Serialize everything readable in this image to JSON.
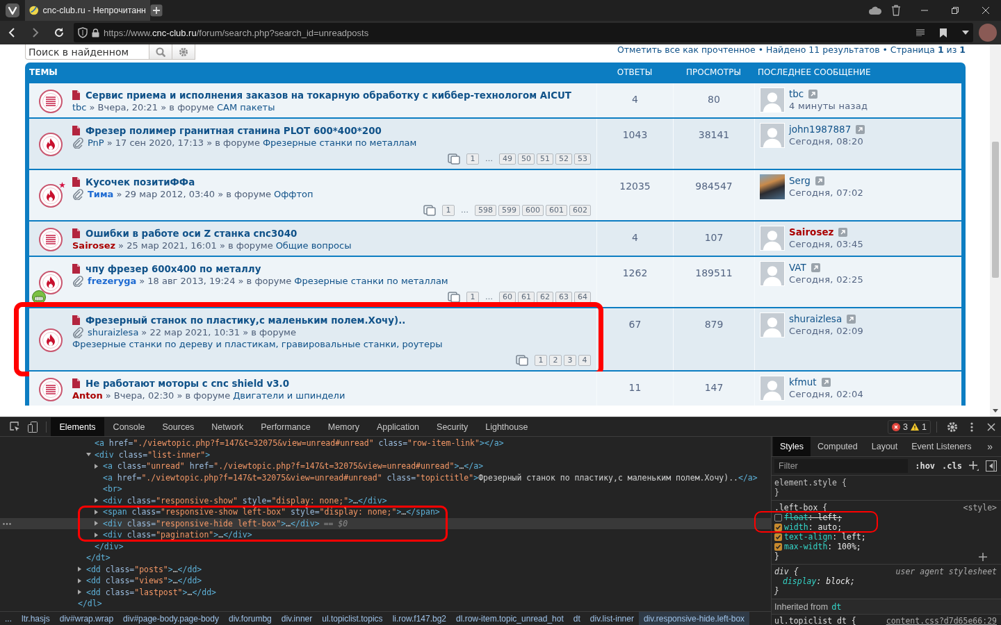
{
  "browser": {
    "tab": {
      "title": "cnc-club.ru - Непрочитанн",
      "selected": true
    },
    "url": {
      "scheme": "https://www.",
      "domain": "cnc-club.ru",
      "path": "/forum/search.php?search_id=unreadposts"
    }
  },
  "search": {
    "placeholder": "Поиск в найденном"
  },
  "search_info": {
    "mark_read": "Отметить все как прочтенное",
    "summary": "• Найдено 11 результатов • Страница **1** из **1**"
  },
  "table": {
    "columns": [
      "ТЕМЫ",
      "ОТВЕТЫ",
      "ПРОСМОТРЫ",
      "ПОСЛЕДНЕЕ СООБЩЕНИЕ"
    ],
    "rows": [
      {
        "kind": "topic",
        "mine": false,
        "attachment": false,
        "smiley": false,
        "highlighted": false,
        "title": "Сервис приема и исполнения заказов на токарную обработку с киббер-технологом AICUT",
        "author": {
          "name": "tbc",
          "kind": "regular"
        },
        "info": "» Вчера, 20:21 » в форуме",
        "forum": "CAM пакеты",
        "replies": "4",
        "views": "80",
        "last_post": {
          "author": {
            "name": "tbc",
            "kind": "regular"
          },
          "avatar": {
            "kind": "default"
          },
          "time": "4 минуты назад"
        }
      },
      {
        "kind": "hot",
        "mine": false,
        "attachment": true,
        "smiley": false,
        "highlighted": false,
        "title": "Фрезер полимер гранитная станина PLOT 600*400*200",
        "author": {
          "name": "PnP",
          "kind": "regular"
        },
        "info": "» 17 сен 2020, 17:13 » в форуме",
        "forum": "Фрезерные станки по металлам",
        "pages": [
          {
            "kind": "page",
            "label": "1"
          },
          {
            "kind": "gap",
            "label": "…"
          },
          {
            "kind": "page",
            "label": "49"
          },
          {
            "kind": "page",
            "label": "50"
          },
          {
            "kind": "page",
            "label": "51"
          },
          {
            "kind": "page",
            "label": "52"
          },
          {
            "kind": "page",
            "label": "53"
          }
        ],
        "replies": "1043",
        "views": "38141",
        "last_post": {
          "author": {
            "name": "john1987887",
            "kind": "regular"
          },
          "avatar": {
            "kind": "default"
          },
          "time": "Сегодня, 08:20"
        }
      },
      {
        "kind": "hot",
        "mine": true,
        "attachment": true,
        "smiley": false,
        "highlighted": false,
        "title": "Кусочек позитиФФа",
        "author": {
          "name": "Тима",
          "kind": "active"
        },
        "info": "» 29 мар 2012, 03:40 » в форуме",
        "forum": "Оффтоп",
        "pages": [
          {
            "kind": "page",
            "label": "1"
          },
          {
            "kind": "gap",
            "label": "…"
          },
          {
            "kind": "page",
            "label": "598"
          },
          {
            "kind": "page",
            "label": "599"
          },
          {
            "kind": "page",
            "label": "600"
          },
          {
            "kind": "page",
            "label": "601"
          },
          {
            "kind": "page",
            "label": "602"
          }
        ],
        "replies": "12035",
        "views": "984547",
        "last_post": {
          "author": {
            "name": "Serg",
            "kind": "regular"
          },
          "avatar": {
            "kind": "photo"
          },
          "time": "Сегодня, 07:02"
        }
      },
      {
        "kind": "topic",
        "mine": false,
        "attachment": false,
        "smiley": false,
        "highlighted": false,
        "title": "Ошибки в работе оси Z станка cnc3040",
        "author": {
          "name": "Sairosez",
          "kind": "staff"
        },
        "info": "» 25 мар 2021, 16:01 » в форуме",
        "forum": "Общие вопросы",
        "replies": "4",
        "views": "107",
        "last_post": {
          "author": {
            "name": "Sairosez",
            "kind": "staff"
          },
          "avatar": {
            "kind": "default"
          },
          "time": "Сегодня, 03:45"
        }
      },
      {
        "kind": "hot",
        "mine": false,
        "attachment": true,
        "smiley": true,
        "highlighted": false,
        "title": "чпу фрезер 600x400 по металлу",
        "author": {
          "name": "frezeryga",
          "kind": "active"
        },
        "info": "» 18 авг 2013, 19:24 » в форуме",
        "forum": "Фрезерные станки по металлам",
        "pages": [
          {
            "kind": "page",
            "label": "1"
          },
          {
            "kind": "gap",
            "label": "…"
          },
          {
            "kind": "page",
            "label": "60"
          },
          {
            "kind": "page",
            "label": "61"
          },
          {
            "kind": "page",
            "label": "62"
          },
          {
            "kind": "page",
            "label": "63"
          },
          {
            "kind": "page",
            "label": "64"
          }
        ],
        "replies": "1262",
        "views": "189511",
        "last_post": {
          "author": {
            "name": "VAT",
            "kind": "regular"
          },
          "avatar": {
            "kind": "default"
          },
          "time": "Сегодня, 02:25"
        }
      },
      {
        "kind": "hot",
        "mine": false,
        "attachment": true,
        "smiley": false,
        "highlighted": true,
        "title": "Фрезерный станок по пластику,с маленьким полем.Хочу)..",
        "author": {
          "name": "shuraizlesa",
          "kind": "regular"
        },
        "info": "» 22 мар 2021, 10:31 » в форуме",
        "forum": "Фрезерные станки по дереву и пластикам, гравировальные станки, роутеры",
        "pages": [
          {
            "kind": "page",
            "label": "1"
          },
          {
            "kind": "page",
            "label": "2"
          },
          {
            "kind": "page",
            "label": "3"
          },
          {
            "kind": "page",
            "label": "4"
          }
        ],
        "replies": "67",
        "views": "879",
        "last_post": {
          "author": {
            "name": "shuraizlesa",
            "kind": "regular"
          },
          "avatar": {
            "kind": "default"
          },
          "time": "Сегодня, 02:09"
        }
      },
      {
        "kind": "topic",
        "mine": false,
        "attachment": false,
        "smiley": false,
        "highlighted": false,
        "title": "Не работают моторы с cnc shield v3.0",
        "author": {
          "name": "Anton",
          "kind": "staff"
        },
        "info": "» Вчера, 02:30 » в форуме",
        "forum": "Двигатели и шпиндели",
        "replies": "11",
        "views": "147",
        "last_post": {
          "author": {
            "name": "kfmut",
            "kind": "regular"
          },
          "avatar": {
            "kind": "default"
          },
          "time": "Сегодня, 02:04"
        }
      }
    ]
  },
  "devtools": {
    "tabs": [
      {
        "label": "Elements",
        "selected": true
      },
      {
        "label": "Console",
        "selected": false
      },
      {
        "label": "Sources",
        "selected": false
      },
      {
        "label": "Network",
        "selected": false
      },
      {
        "label": "Performance",
        "selected": false
      },
      {
        "label": "Memory",
        "selected": false
      },
      {
        "label": "Application",
        "selected": false
      },
      {
        "label": "Security",
        "selected": false
      },
      {
        "label": "Lighthouse",
        "selected": false
      }
    ],
    "issues": {
      "errors": "3",
      "warnings": "1"
    },
    "dom_tree": {
      "closing": "</dl>",
      "children": [
        {
          "closing": "</dt>",
          "children": [
            {
              "markup": "<a href=\"./viewtopic.php?f=147&t=32075&view=unread#unread\" class=\"row-item-link\"></a>",
              "selected": false
            },
            {
              "markup": "<div class=\"list-inner\">",
              "expanded": true,
              "selected": false,
              "closing": "</div>",
              "children": [
                {
                  "markup": "<a class=\"unread\" href=\"./viewtopic.php?f=147&t=32075&view=unread#unread\">…</a>",
                  "expanded": false,
                  "selected": false
                },
                {
                  "markup": "<a href=\"./viewtopic.php?f=147&t=32075&view=unread#unread\" class=\"topictitle\">Фрезерный станок по пластику,с маленьким полем.Хочу)..</a>",
                  "selected": false
                },
                {
                  "markup": "<br>",
                  "selected": false
                },
                {
                  "markup": "<div class=\"responsive-show\" style=\"display: none;\">…</div>",
                  "expanded": false,
                  "selected": false
                },
                {
                  "markup": "<span class=\"responsive-show left-box\" style=\"display: none;\">…</span>",
                  "expanded": false,
                  "selected": false
                },
                {
                  "markup": "<div class=\"responsive-hide left-box\">…</div>",
                  "badge": "== $0",
                  "expanded": false,
                  "selected": true
                },
                {
                  "markup": "<div class=\"pagination\">…</div>",
                  "expanded": false,
                  "selected": false
                }
              ]
            }
          ]
        },
        {
          "markup": "<dd class=\"posts\">…</dd>",
          "expanded": false,
          "selected": false
        },
        {
          "markup": "<dd class=\"views\">…</dd>",
          "expanded": false,
          "selected": false
        },
        {
          "markup": "<dd class=\"lastpost\">…</dd>",
          "expanded": false,
          "selected": false
        }
      ]
    },
    "breadcrumbs": [
      {
        "label": "...",
        "selected": false
      },
      {
        "label": "ltr.hasjs",
        "selected": false
      },
      {
        "label": "div#wrap.wrap",
        "selected": false
      },
      {
        "label": "div#page-body.page-body",
        "selected": false
      },
      {
        "label": "div.forumbg",
        "selected": false
      },
      {
        "label": "div.inner",
        "selected": false
      },
      {
        "label": "ul.topiclist.topics",
        "selected": false
      },
      {
        "label": "li.row.f147.bg2",
        "selected": false
      },
      {
        "label": "dl.row-item.topic_unread_hot",
        "selected": false
      },
      {
        "label": "dt",
        "selected": false
      },
      {
        "label": "div.list-inner",
        "selected": false
      },
      {
        "label": "div.responsive-hide.left-box",
        "selected": true
      }
    ],
    "styles": {
      "tabs": [
        {
          "label": "Styles",
          "selected": true
        },
        {
          "label": "Computed",
          "selected": false
        },
        {
          "label": "Layout",
          "selected": false
        },
        {
          "label": "Event Listeners",
          "selected": false
        }
      ],
      "more": "»",
      "filter": {
        "placeholder": "Filter"
      },
      "toggles": [
        ":hov",
        ".cls"
      ],
      "rules": [
        {
          "kind": "inline",
          "selector": "element.style {",
          "closing": "}"
        },
        {
          "kind": "author",
          "selector": ".left-box {",
          "source": "<style>",
          "closing": "}",
          "properties": [
            {
              "name": "float",
              "value": ": left;",
              "checked": false
            },
            {
              "name": "width",
              "value": ": auto;",
              "checked": true
            },
            {
              "name": "text-align",
              "value": ": left;",
              "checked": true
            },
            {
              "name": "max-width",
              "value": ": 100%;",
              "checked": true
            }
          ]
        },
        {
          "kind": "user-agent",
          "selector": "div {",
          "source": "user agent stylesheet",
          "closing": "}",
          "properties": [
            {
              "name": "display",
              "value": ": block;"
            }
          ]
        }
      ],
      "inherited_label": "Inherited from",
      "inherited_from": "dt",
      "next_rule": {
        "selector": "ul.topiclist dt {",
        "source": "content.css?d7d65e66:29"
      }
    }
  }
}
